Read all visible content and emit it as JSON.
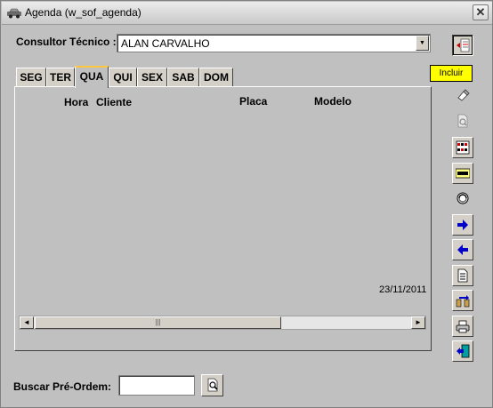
{
  "window": {
    "title": "Agenda  (w_sof_agenda)",
    "close_symbol": "✕"
  },
  "consultor": {
    "label": "Consultor Técnico :",
    "value": "ALAN CARVALHO"
  },
  "tabs": [
    {
      "label": "SEG",
      "active": false
    },
    {
      "label": "TER",
      "active": false
    },
    {
      "label": "QUA",
      "active": true
    },
    {
      "label": "QUI",
      "active": false
    },
    {
      "label": "SEX",
      "active": false
    },
    {
      "label": "SAB",
      "active": false
    },
    {
      "label": "DOM",
      "active": false
    }
  ],
  "columns": {
    "hora": "Hora",
    "cliente": "Cliente",
    "placa": "Placa",
    "modelo": "Modelo"
  },
  "date": "23/11/2011",
  "tooltip": "Incluir",
  "toolbar": [
    {
      "name": "incluir-icon"
    },
    {
      "name": "eraser-icon"
    },
    {
      "name": "preview-icon"
    },
    {
      "name": "calendar-icon"
    },
    {
      "name": "hbl-icon"
    },
    {
      "name": "refresh-icon"
    },
    {
      "name": "arrow-right-icon"
    },
    {
      "name": "arrow-left-icon"
    },
    {
      "name": "document-icon"
    },
    {
      "name": "transfer-icon"
    },
    {
      "name": "printer-icon"
    },
    {
      "name": "exit-icon"
    }
  ],
  "scroll_thumb_grip": "|||",
  "scroll_left": "◄",
  "scroll_right": "►",
  "dropdown_arrow": "▼",
  "buscar": {
    "label": "Buscar Pré-Ordem:",
    "value": ""
  },
  "colors": {
    "window_bg": "#c0c0c0",
    "tooltip_bg": "#ffff00",
    "active_tab_accent": "#ffc83d",
    "arrow_blue": "#0000c8"
  }
}
